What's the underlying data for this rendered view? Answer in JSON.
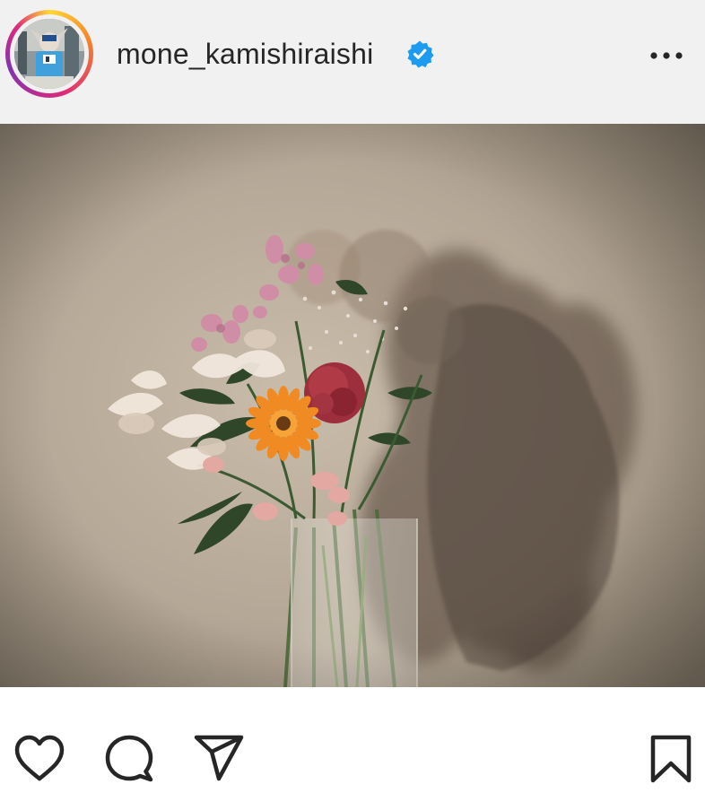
{
  "post": {
    "username": "mone_kamishiraishi",
    "verified": true,
    "avatar_icon": "profile-avatar-icon",
    "verified_icon": "verified-badge-icon",
    "more_icon": "more-options-icon",
    "photo_icon": "flower-bouquet-image",
    "actions": {
      "like_icon": "heart-icon",
      "comment_icon": "comment-icon",
      "share_icon": "paper-plane-icon",
      "save_icon": "bookmark-icon"
    }
  },
  "colors": {
    "header_bg": "#f1f1f1",
    "username": "#262626",
    "verified": "#1d9bf0",
    "icon": "#262626"
  }
}
